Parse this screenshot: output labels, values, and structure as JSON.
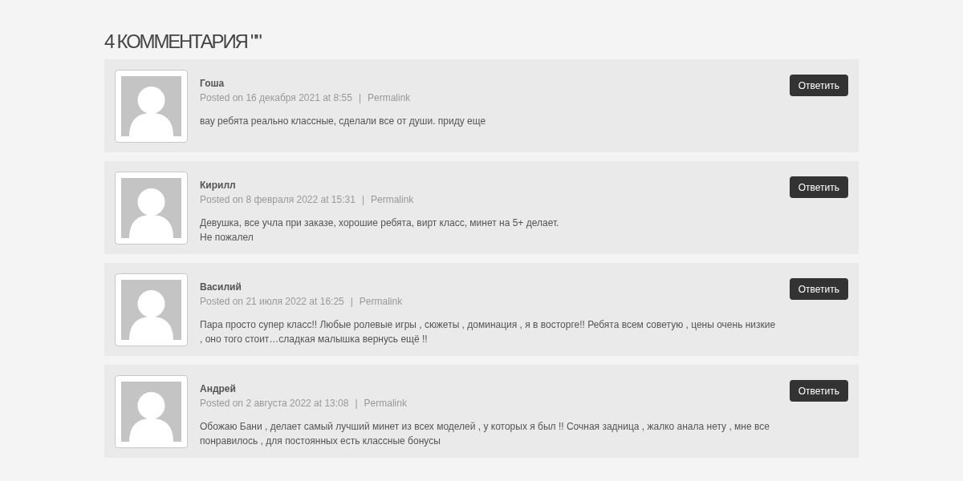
{
  "heading": "4 КОММЕНТАРИЯ \"\"",
  "comments": [
    {
      "author": "Гоша",
      "posted": "Posted on 16 декабря 2021 at 8:55",
      "separator": "|",
      "permalink": "Permalink",
      "body": [
        "вау ребята реально классные, сделали все от души. приду еще"
      ],
      "reply": "Ответить"
    },
    {
      "author": "Кирилл",
      "posted": "Posted on 8 февраля 2022 at 15:31",
      "separator": "|",
      "permalink": "Permalink",
      "body": [
        "Девушка, все учла при заказе, хорошие ребята, вирт класс, минет на 5+ делает.",
        "Не пожалел"
      ],
      "reply": "Ответить"
    },
    {
      "author": "Василий",
      "posted": "Posted on 21 июля 2022 at 16:25",
      "separator": "|",
      "permalink": "Permalink",
      "body": [
        "Пара просто супер класс!! Любые ролевые игры , сюжеты , доминация , я в восторге!! Ребята всем советую , цены очень низкие , оно того стоит…сладкая малышка вернусь ещё !!"
      ],
      "reply": "Ответить"
    },
    {
      "author": "Андрей",
      "posted": "Posted on 2 августа 2022 at 13:08",
      "separator": "|",
      "permalink": "Permalink",
      "body": [
        "Обожаю Бани , делает самый лучший минет из всех моделей , у которых я был !! Сочная задница , жалко анала нету , мне все понравилось , для постоянных есть классные бонусы"
      ],
      "reply": "Ответить"
    }
  ]
}
